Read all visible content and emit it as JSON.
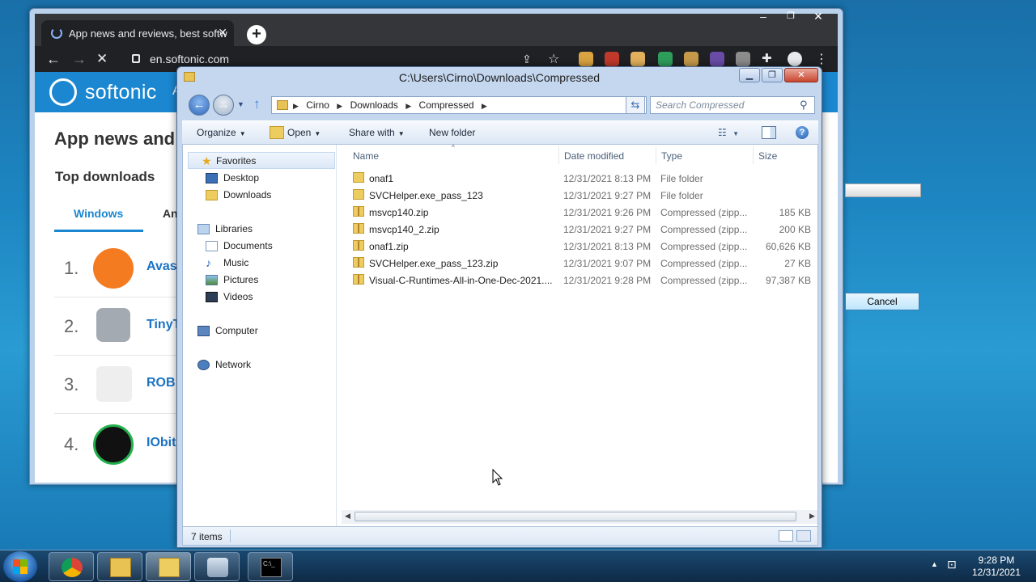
{
  "chrome": {
    "tab_title": "App news and reviews, best softw",
    "url": "en.softonic.com",
    "page": {
      "logo_text": "softonic",
      "nav_partial": "A",
      "heading": "App news and",
      "subheading": "Top downloads",
      "tab_windows": "Windows",
      "tab_android_partial": "An",
      "apps": [
        {
          "rank": "1.",
          "name": "Avas",
          "color": "#f47b20"
        },
        {
          "rank": "2.",
          "name": "TinyT",
          "color": "#9aa0a8"
        },
        {
          "rank": "3.",
          "name": "ROB",
          "color": "#e8e8e8"
        },
        {
          "rank": "4.",
          "name": "IObit",
          "color": "#0c8a3a"
        }
      ]
    }
  },
  "background_dialog": {
    "cancel_label": "Cancel"
  },
  "explorer": {
    "title": "C:\\Users\\Cirno\\Downloads\\Compressed",
    "breadcrumb": [
      "Cirno",
      "Downloads",
      "Compressed"
    ],
    "search_placeholder": "Search Compressed",
    "toolbar": {
      "organize": "Organize",
      "open": "Open",
      "share_with": "Share with",
      "new_folder": "New folder"
    },
    "nav": {
      "favorites": "Favorites",
      "desktop": "Desktop",
      "downloads": "Downloads",
      "libraries": "Libraries",
      "documents": "Documents",
      "music": "Music",
      "pictures": "Pictures",
      "videos": "Videos",
      "computer": "Computer",
      "network": "Network"
    },
    "columns": {
      "name": "Name",
      "date": "Date modified",
      "type": "Type",
      "size": "Size"
    },
    "files": [
      {
        "name": "onaf1",
        "date": "12/31/2021 8:13 PM",
        "type": "File folder",
        "size": "",
        "kind": "folder"
      },
      {
        "name": "SVCHelper.exe_pass_123",
        "date": "12/31/2021 9:27 PM",
        "type": "File folder",
        "size": "",
        "kind": "folder"
      },
      {
        "name": "msvcp140.zip",
        "date": "12/31/2021 9:26 PM",
        "type": "Compressed (zipp...",
        "size": "185 KB",
        "kind": "zip"
      },
      {
        "name": "msvcp140_2.zip",
        "date": "12/31/2021 9:27 PM",
        "type": "Compressed (zipp...",
        "size": "200 KB",
        "kind": "zip"
      },
      {
        "name": "onaf1.zip",
        "date": "12/31/2021 8:13 PM",
        "type": "Compressed (zipp...",
        "size": "60,626 KB",
        "kind": "zip"
      },
      {
        "name": "SVCHelper.exe_pass_123.zip",
        "date": "12/31/2021 9:07 PM",
        "type": "Compressed (zipp...",
        "size": "27 KB",
        "kind": "zip"
      },
      {
        "name": "Visual-C-Runtimes-All-in-One-Dec-2021....",
        "date": "12/31/2021 9:28 PM",
        "type": "Compressed (zipp...",
        "size": "97,387 KB",
        "kind": "zip"
      }
    ],
    "status": "7 items"
  },
  "taskbar": {
    "time": "9:28 PM",
    "date": "12/31/2021"
  }
}
